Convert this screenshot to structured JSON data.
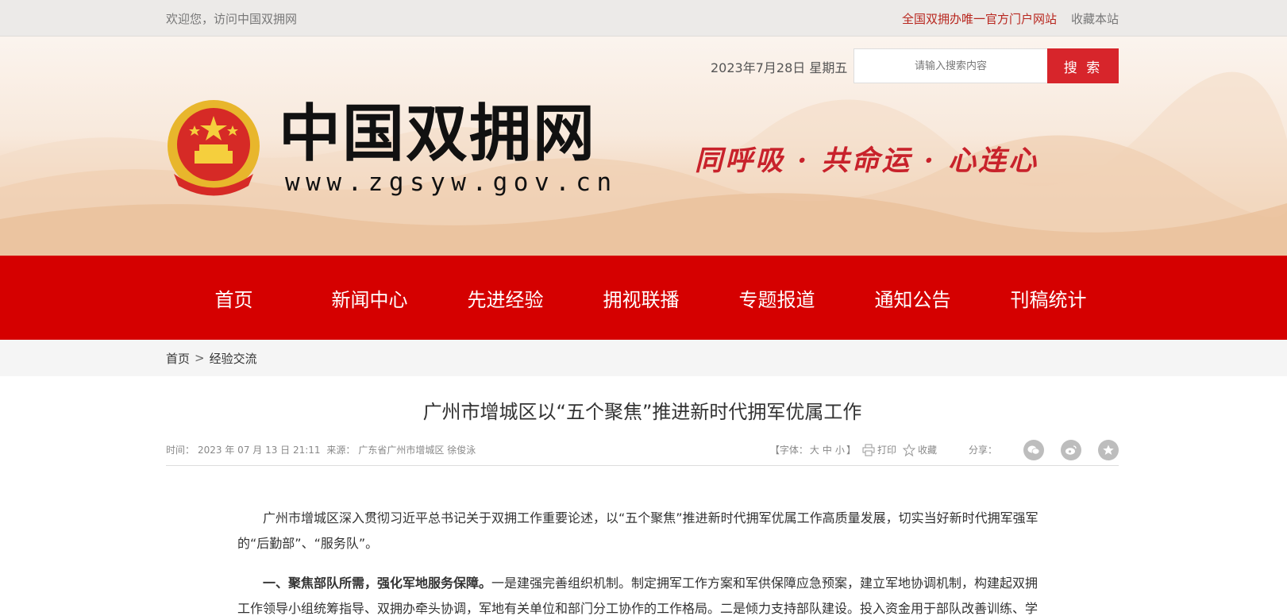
{
  "topbar": {
    "welcome": "欢迎您，访问中国双拥网",
    "official": "全国双拥办唯一官方门户网站",
    "favorite": "收藏本站"
  },
  "header": {
    "date": "2023年7月28日 星期五",
    "search_placeholder": "请输入搜索内容",
    "search_button": "搜 索",
    "site_name": "中国双拥网",
    "site_url": "www.zgsyw.gov.cn",
    "slogan": "同呼吸 · 共命运 · 心连心"
  },
  "nav": {
    "items": [
      "首页",
      "新闻中心",
      "先进经验",
      "拥视联播",
      "专题报道",
      "通知公告",
      "刊稿统计"
    ]
  },
  "breadcrumb": {
    "home": "首页",
    "sep": ">",
    "current": "经验交流"
  },
  "article": {
    "title": "广州市增城区以“五个聚焦”推进新时代拥军优属工作",
    "time_label": "时间：",
    "time_value": "2023 年 07 月 13 日 21:11",
    "source_label": "来源：",
    "source_value": "广东省广州市增城区 徐俊泳",
    "font_open": "【字体：",
    "font_large": "大",
    "font_medium": "中",
    "font_small": "小",
    "font_close": "】",
    "print": "打印",
    "collect": "收藏",
    "share": "分享：",
    "para1": "广州市增城区深入贯彻习近平总书记关于双拥工作重要论述，以“五个聚焦”推进新时代拥军优属工作高质量发展，切实当好新时代拥军强军的“后勤部”、“服务队”。",
    "para2_bold": "一、聚焦部队所需，强化军地服务保障。",
    "para2_text": "一是建强完善组织机制。制定拥军工作方案和军供保障应急预案，建立军地协调机制，构建起双拥工作领导小组统筹指导、双拥办牵头协调，军地有关单位和部门分工协作的工作格局。二是倾力支持部队建设。投入资金用于部队改善训练、学"
  },
  "colors": {
    "brand_red": "#d50000",
    "button_red": "#d7252b",
    "slogan_red": "#c8222b"
  }
}
